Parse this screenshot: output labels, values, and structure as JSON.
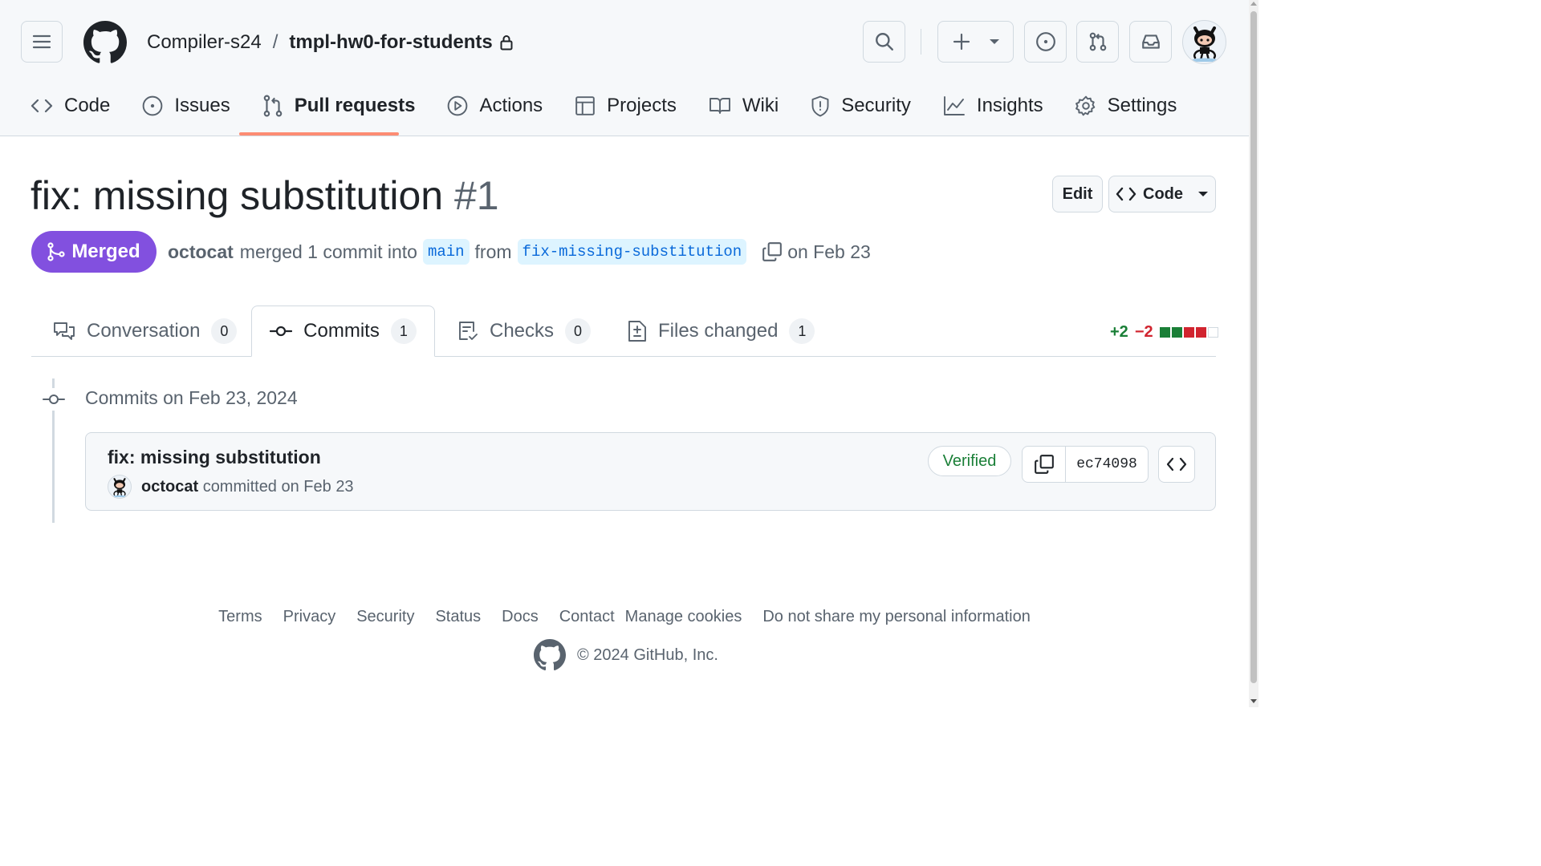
{
  "breadcrumb": {
    "owner": "Compiler-s24",
    "separator": "/",
    "repo": "tmpl-hw0-for-students"
  },
  "repo_nav": {
    "code": "Code",
    "issues": "Issues",
    "pull_requests": "Pull requests",
    "actions": "Actions",
    "projects": "Projects",
    "wiki": "Wiki",
    "security": "Security",
    "insights": "Insights",
    "settings": "Settings"
  },
  "pr": {
    "title": "fix: missing substitution",
    "number": "#1",
    "state": "Merged",
    "author": "octocat",
    "meta_text": "merged 1 commit into",
    "base_branch": "main",
    "from_text": "from",
    "head_branch": "fix-missing-substitution",
    "date_text": "on Feb 23",
    "edit_label": "Edit",
    "code_label": "Code"
  },
  "tabs": {
    "conversation": {
      "label": "Conversation",
      "count": "0"
    },
    "commits": {
      "label": "Commits",
      "count": "1"
    },
    "checks": {
      "label": "Checks",
      "count": "0"
    },
    "files": {
      "label": "Files changed",
      "count": "1"
    }
  },
  "diffstat": {
    "additions": "+2",
    "deletions": "−2"
  },
  "commits": {
    "date_heading": "Commits on Feb 23, 2024",
    "items": [
      {
        "title": "fix: missing substitution",
        "author": "octocat",
        "committed_text": "committed on Feb 23",
        "verified": "Verified",
        "sha": "ec74098"
      }
    ]
  },
  "footer": {
    "links": {
      "terms": "Terms",
      "privacy": "Privacy",
      "security": "Security",
      "status": "Status",
      "docs": "Docs",
      "contact": "Contact",
      "cookies": "Manage cookies",
      "do_not_share": "Do not share my personal information"
    },
    "copyright": "© 2024 GitHub, Inc."
  },
  "colors": {
    "merged": "#8250df",
    "accent_underline": "#fd8c73",
    "additions": "#1a7f37",
    "deletions": "#d1242f",
    "link": "#0969da"
  }
}
